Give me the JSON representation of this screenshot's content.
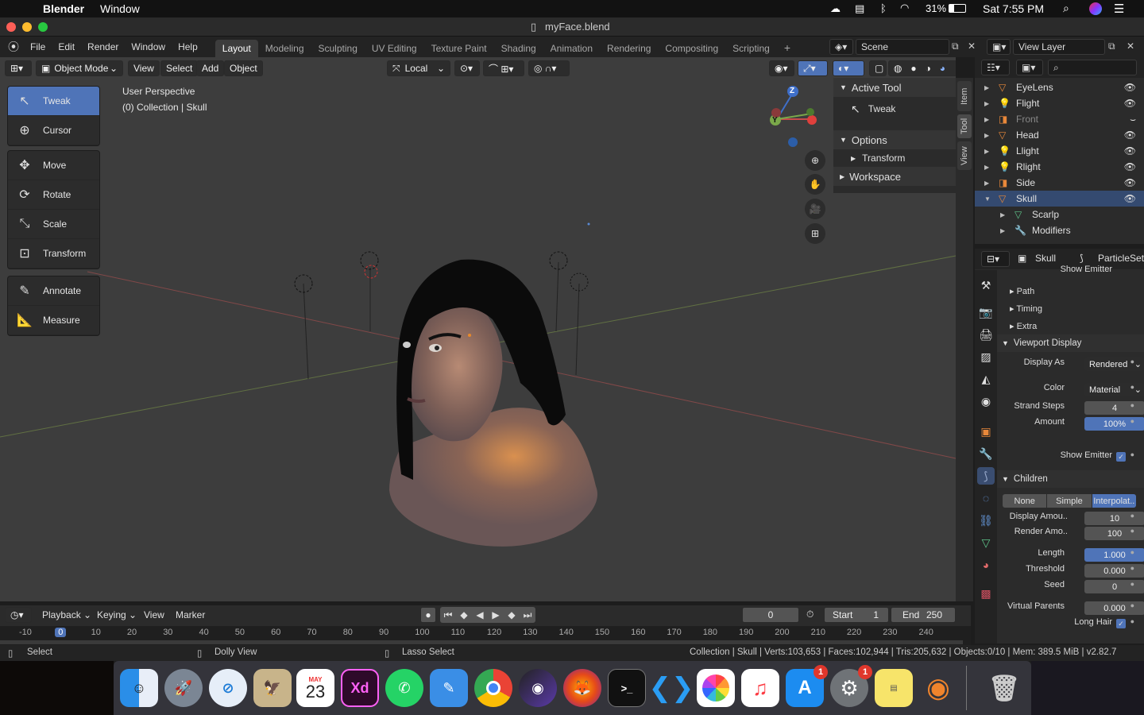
{
  "menubar": {
    "app_name": "Blender",
    "window_menu": "Window",
    "battery": "31%",
    "clock": "Sat 7:55 PM"
  },
  "titlebar": {
    "title": "myFace.blend"
  },
  "topbar": {
    "menus": [
      "File",
      "Edit",
      "Render",
      "Window",
      "Help"
    ],
    "workspace_tabs": [
      "Layout",
      "Modeling",
      "Sculpting",
      "UV Editing",
      "Texture Paint",
      "Shading",
      "Animation",
      "Rendering",
      "Compositing",
      "Scripting"
    ],
    "active_tab": "Layout",
    "scene": "Scene",
    "view_layer": "View Layer"
  },
  "viewport": {
    "mode": "Object Mode",
    "menus": [
      "View",
      "Select",
      "Add",
      "Object"
    ],
    "orientation": "Local",
    "perspective_label": "User Perspective",
    "collection_label": "(0) Collection | Skull",
    "tools": [
      "Tweak",
      "Cursor",
      "Move",
      "Rotate",
      "Scale",
      "Transform",
      "Annotate",
      "Measure"
    ],
    "active_tool": "Tweak",
    "gizmo_axes": {
      "z": "Z",
      "y": "Y"
    }
  },
  "npanel": {
    "active_tool_header": "Active Tool",
    "active_tool_value": "Tweak",
    "options_header": "Options",
    "transform": "Transform",
    "workspace": "Workspace",
    "tabs": [
      "Item",
      "Tool",
      "View"
    ]
  },
  "outliner": {
    "items": [
      {
        "name": "EyeLens",
        "icon": "mesh-icon"
      },
      {
        "name": "Flight",
        "icon": "light-icon"
      },
      {
        "name": "Front",
        "icon": "camera-icon"
      },
      {
        "name": "Head",
        "icon": "mesh-icon"
      },
      {
        "name": "Llight",
        "icon": "light-icon"
      },
      {
        "name": "Rlight",
        "icon": "light-icon"
      },
      {
        "name": "Side",
        "icon": "camera-icon"
      },
      {
        "name": "Skull",
        "icon": "mesh-icon"
      },
      {
        "name": "Scarlp",
        "icon": "particles-icon"
      },
      {
        "name": "Modifiers",
        "icon": "wrench-icon"
      }
    ],
    "selected": "Skull"
  },
  "properties": {
    "object_name": "Skull",
    "particle_settings": "ParticleSett",
    "show_emitter_top": "Show Emitter",
    "sections": [
      "Path",
      "Timing",
      "Extra"
    ],
    "viewport_display": "Viewport Display",
    "display_as_label": "Display As",
    "display_as_value": "Rendered",
    "color_label": "Color",
    "color_value": "Material",
    "strand_steps_label": "Strand Steps",
    "strand_steps_value": "4",
    "amount_label": "Amount",
    "amount_value": "100%",
    "show_emitter_label": "Show Emitter",
    "children": "Children",
    "children_options": [
      "None",
      "Simple",
      "Interpolat.."
    ],
    "children_active": "Interpolat..",
    "display_amount_label": "Display Amou..",
    "display_amount_value": "10",
    "render_amount_label": "Render Amo..",
    "render_amount_value": "100",
    "length_label": "Length",
    "length_value": "1.000",
    "threshold_label": "Threshold",
    "threshold_value": "0.000",
    "seed_label": "Seed",
    "seed_value": "0",
    "virtual_parents_label": "Virtual Parents",
    "virtual_parents_value": "0.000",
    "long_hair_label": "Long Hair"
  },
  "timeline": {
    "menus": [
      "Playback",
      "Keying",
      "View",
      "Marker"
    ],
    "current_frame": "0",
    "start_label": "Start",
    "start_value": "1",
    "end_label": "End",
    "end_value": "250",
    "ticks": [
      "-10",
      "0",
      "10",
      "20",
      "30",
      "40",
      "50",
      "60",
      "70",
      "80",
      "90",
      "100",
      "110",
      "120",
      "130",
      "140",
      "150",
      "160",
      "170",
      "180",
      "190",
      "200",
      "210",
      "220",
      "230",
      "240"
    ]
  },
  "statusbar": {
    "select": "Select",
    "dolly": "Dolly View",
    "lasso": "Lasso Select",
    "stats": "Collection | Skull | Verts:103,653 | Faces:102,944 | Tris:205,632 | Objects:0/10 | Mem: 389.5 MiB | v2.82.7"
  },
  "dock": {
    "calendar_month": "MAY",
    "calendar_day": "23",
    "xd": "Xd",
    "appstore_badge": "1",
    "prefs_badge": "1"
  }
}
